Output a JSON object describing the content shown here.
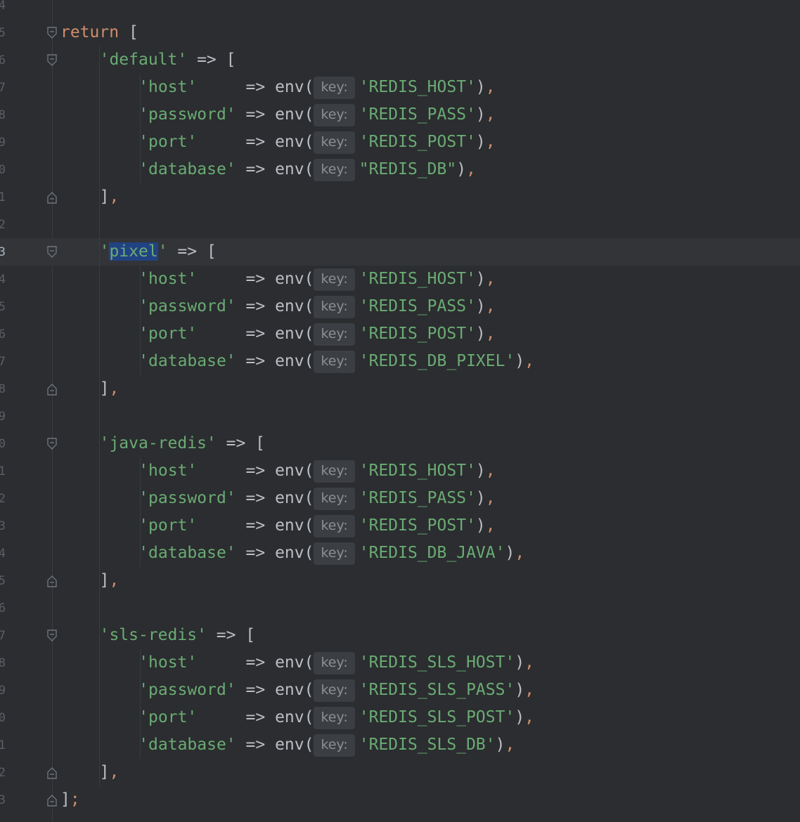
{
  "editor": {
    "line_numbers": [
      "4",
      "5",
      "6",
      "7",
      "8",
      "9",
      "0",
      "1",
      "2",
      "3",
      "4",
      "5",
      "6",
      "7",
      "8",
      "9",
      "0",
      "1",
      "2",
      "3",
      "4",
      "5",
      "6",
      "7",
      "8",
      "9",
      "0",
      "1",
      "2",
      "3"
    ],
    "keyword_return": "return",
    "hint_label": "key:",
    "groups": [
      {
        "name": "'default'",
        "entries": [
          {
            "key": "'host'",
            "pad": "     ",
            "value": "'REDIS_HOST'"
          },
          {
            "key": "'password'",
            "pad": " ",
            "value": "'REDIS_PASS'"
          },
          {
            "key": "'port'",
            "pad": "     ",
            "value": "'REDIS_POST'"
          },
          {
            "key": "'database'",
            "pad": " ",
            "value": "\"REDIS_DB\""
          }
        ]
      },
      {
        "name": "'pixel'",
        "entries": [
          {
            "key": "'host'",
            "pad": "     ",
            "value": "'REDIS_HOST'"
          },
          {
            "key": "'password'",
            "pad": " ",
            "value": "'REDIS_PASS'"
          },
          {
            "key": "'port'",
            "pad": "     ",
            "value": "'REDIS_POST'"
          },
          {
            "key": "'database'",
            "pad": " ",
            "value": "'REDIS_DB_PIXEL'"
          }
        ]
      },
      {
        "name": "'java-redis'",
        "entries": [
          {
            "key": "'host'",
            "pad": "     ",
            "value": "'REDIS_HOST'"
          },
          {
            "key": "'password'",
            "pad": " ",
            "value": "'REDIS_PASS'"
          },
          {
            "key": "'port'",
            "pad": "     ",
            "value": "'REDIS_POST'"
          },
          {
            "key": "'database'",
            "pad": " ",
            "value": "'REDIS_DB_JAVA'"
          }
        ]
      },
      {
        "name": "'sls-redis'",
        "entries": [
          {
            "key": "'host'",
            "pad": "     ",
            "value": "'REDIS_SLS_HOST'"
          },
          {
            "key": "'password'",
            "pad": " ",
            "value": "'REDIS_SLS_PASS'"
          },
          {
            "key": "'port'",
            "pad": "     ",
            "value": "'REDIS_SLS_POST'"
          },
          {
            "key": "'database'",
            "pad": " ",
            "value": "'REDIS_SLS_DB'"
          }
        ]
      }
    ],
    "selected_text": "pixel",
    "colors": {
      "background": "#2b2d30",
      "keyword": "#cf8e6d",
      "string": "#6aab73",
      "text": "#bcbec4",
      "selection": "#214283",
      "current_line": "#323438"
    }
  }
}
